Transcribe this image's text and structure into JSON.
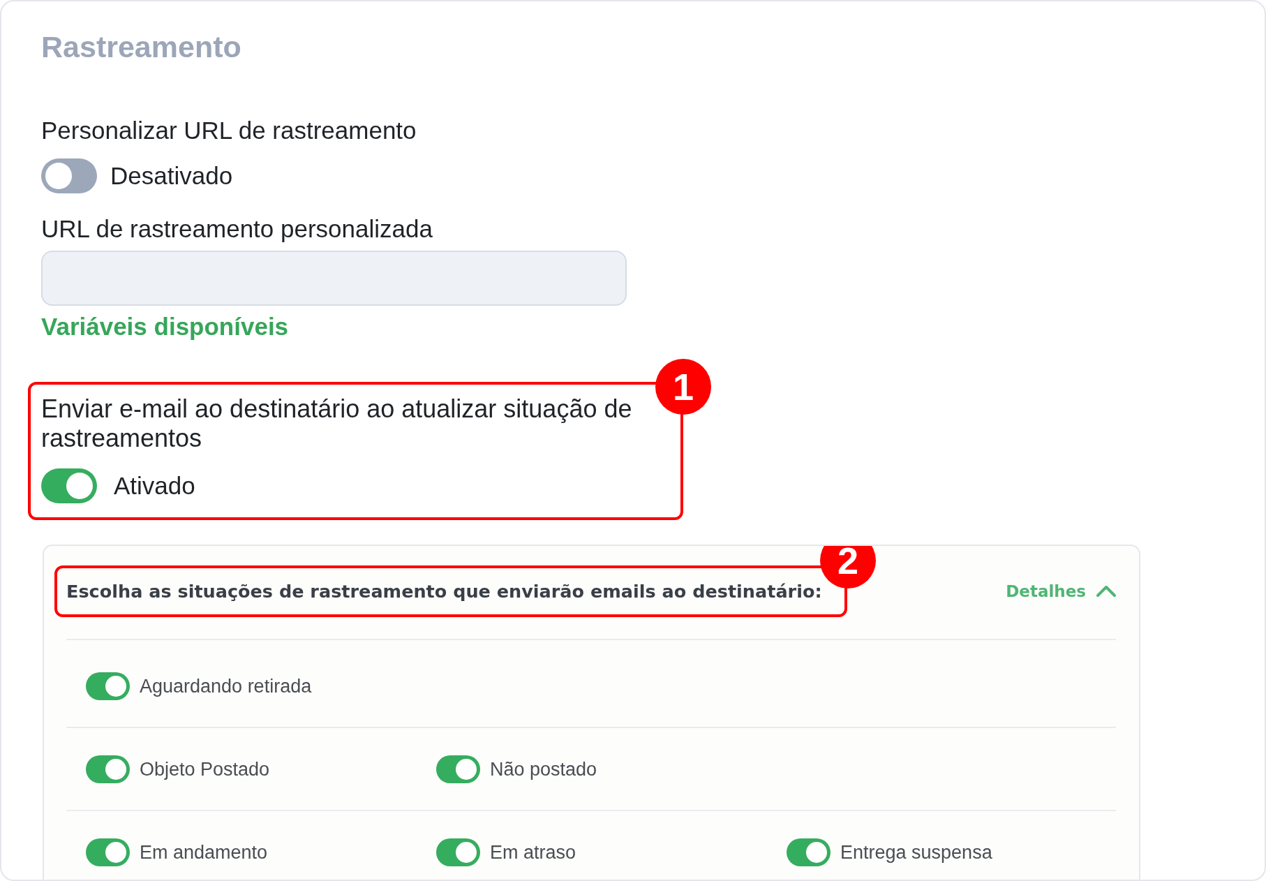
{
  "title": "Rastreamento",
  "custom_url": {
    "label": "Personalizar URL de rastreamento",
    "on": false,
    "state_label": "Desativado"
  },
  "custom_url_field": {
    "label": "URL de rastreamento personalizada"
  },
  "variables_link": "Variáveis disponíveis",
  "email_notify": {
    "callout": "1",
    "label": "Enviar e-mail ao destinatário ao atualizar situação de rastreamentos",
    "on": true,
    "state_label": "Ativado"
  },
  "status_panel": {
    "callout": "2",
    "heading": "Escolha as situações de rastreamento que enviarão emails ao destinatário:",
    "details_link": "Detalhes",
    "expanded": true,
    "rows": [
      {
        "items": [
          {
            "label": "Aguardando retirada",
            "on": true
          }
        ]
      },
      {
        "items": [
          {
            "label": "Objeto Postado",
            "on": true
          },
          {
            "label": "Não postado",
            "on": true
          }
        ]
      },
      {
        "items": [
          {
            "label": "Em andamento",
            "on": true
          },
          {
            "label": "Em atraso",
            "on": true
          },
          {
            "label": "Entrega suspensa",
            "on": true
          }
        ]
      }
    ]
  }
}
